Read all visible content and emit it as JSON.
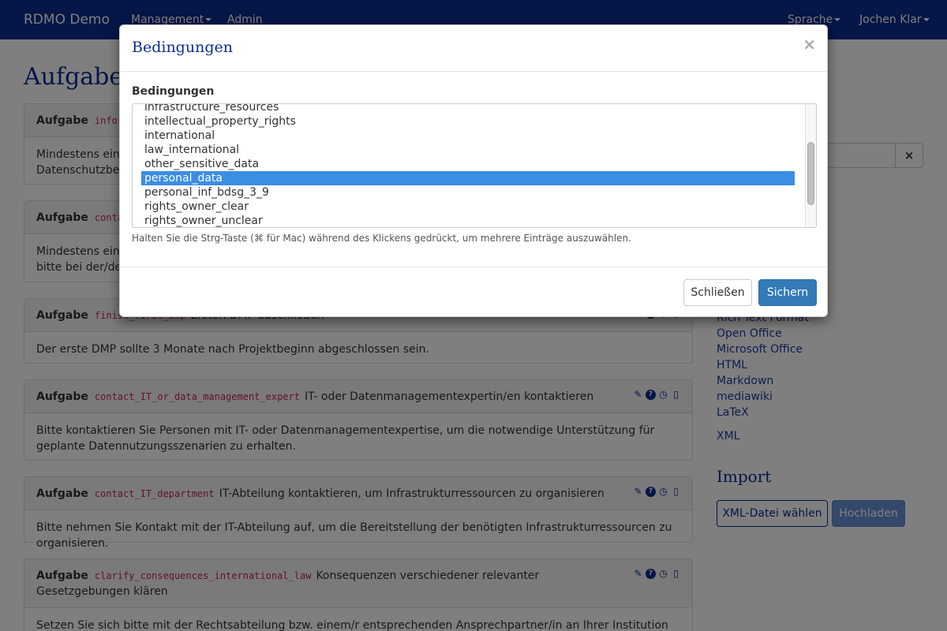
{
  "navbar": {
    "brand": "RDMO Demo",
    "management": "Management",
    "admin": "Admin",
    "language": "Sprache",
    "user": "Jochen Klar"
  },
  "page": {
    "title": "Aufgaben"
  },
  "tasks": [
    {
      "label": "Aufgabe",
      "key": "information",
      "title": "",
      "body": "Mindestens ein D\nDatenschutzbeau"
    },
    {
      "label": "Aufgabe",
      "key": "contact",
      "title": "",
      "body": "Mindestens eine\nbitte bei der/dem"
    },
    {
      "label": "Aufgabe",
      "key": "finish_first_dmp",
      "title": "Ersten DMP abschließen",
      "body": "Der erste DMP sollte 3 Monate nach Projektbeginn abgeschlossen sein."
    },
    {
      "label": "Aufgabe",
      "key": "contact_IT_or_data_management_expert",
      "title": "IT- oder Datenmanagementexpertin/en kontaktieren",
      "body": "Bitte kontaktieren Sie Personen mit IT- oder Datenmanagementexpertise, um die notwendige Unterstützung für geplante Datennutzungsszenarien zu erhalten."
    },
    {
      "label": "Aufgabe",
      "key": "contact_IT_department",
      "title": "IT-Abteilung kontaktieren, um Infrastrukturressourcen zu organisieren",
      "body": "Bitte nehmen Sie Kontakt mit der IT-Abteilung auf, um die Bereitstellung der benötigten Infrastrukturressourcen zu organisieren."
    },
    {
      "label": "Aufgabe",
      "key": "clarify_consequences_international_law",
      "title": "Konsequenzen verschiedener relevanter Gesetzgebungen klären",
      "body": "Setzen Sie sich bitte mit der Rechtsabteilung bzw. einem/r entsprechenden Ansprechpartner/in an Ihrer Institution in"
    }
  ],
  "sidebar": {
    "export_links": [
      "Rich Text Format",
      "Open Office",
      "Microsoft Office",
      "HTML",
      "Markdown",
      "mediawiki",
      "LaTeX",
      "XML"
    ],
    "import_title": "Import",
    "file_button": "XML-Datei wählen",
    "upload_button": "Hochladen",
    "clear_icon": "×"
  },
  "modal": {
    "title": "Bedingungen",
    "close_icon": "×",
    "field_label": "Bedingungen",
    "options": [
      "infrastructure_resources",
      "intellectual_property_rights",
      "international",
      "law_international",
      "other_sensitive_data",
      "personal_data",
      "personal_inf_bdsg_3_9",
      "rights_owner_clear",
      "rights_owner_unclear"
    ],
    "selected": "personal_data",
    "help_text": "Halten Sie die Strg-Taste (⌘ für Mac) während des Klickens gedrückt, um mehrere Einträge auszuwählen.",
    "close_button": "Schließen",
    "save_button": "Sichern"
  },
  "colors": {
    "navbar": "#0a2d8f",
    "primary_button": "#337ab7",
    "selection": "#3b8ee3",
    "code": "#c7254e"
  }
}
